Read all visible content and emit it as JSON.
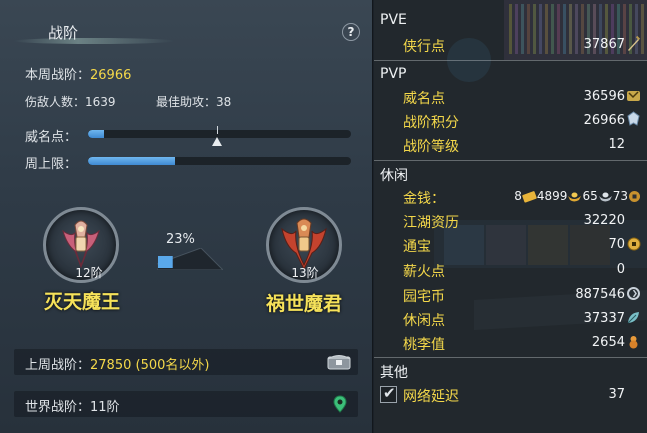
{
  "left": {
    "header": {
      "title": "战阶"
    },
    "help_label": "?",
    "weekly_rank": {
      "label": "本周战阶：",
      "value": "26966"
    },
    "stats": {
      "injured_label": "伤敌人数：",
      "injured_value": "1639",
      "assist_label": "最佳助攻：",
      "assist_value": "38"
    },
    "prestige": {
      "label": "威名点：",
      "fill_fraction": 0.06,
      "marker_fraction": 0.49
    },
    "weekly_cap": {
      "label": "周上限：",
      "fill_fraction": 0.33
    },
    "current_rank": {
      "level": "12阶",
      "name": "灭天魔王"
    },
    "progress_percent": "23%",
    "progress_fraction": 0.23,
    "next_rank": {
      "level": "13阶",
      "name": "祸世魔君"
    },
    "last_week": {
      "label": "上周战阶：",
      "value": "27850 (500名以外)"
    },
    "world_rank": {
      "label": "世界战阶：",
      "value": "11阶"
    }
  },
  "right": {
    "pve": {
      "section": "PVE",
      "items": [
        {
          "label": "侠行点",
          "value": "37867"
        }
      ]
    },
    "pvp": {
      "section": "PVP",
      "items": [
        {
          "label": "威名点",
          "value": "36596"
        },
        {
          "label": "战阶积分",
          "value": "26966"
        },
        {
          "label": "战阶等级",
          "value": "12"
        }
      ]
    },
    "leisure": {
      "section": "休闲",
      "money_label": "金钱：",
      "money": {
        "a": "8",
        "b": "4899",
        "c": "65",
        "d": "73"
      },
      "items": [
        {
          "label": "江湖资历",
          "value": "32220"
        },
        {
          "label": "通宝",
          "value": "70"
        },
        {
          "label": "薪火点",
          "value": "0"
        },
        {
          "label": "园宅币",
          "value": "887546"
        },
        {
          "label": "休闲点",
          "value": "37337"
        },
        {
          "label": "桃李值",
          "value": "2654"
        }
      ]
    },
    "other": {
      "section": "其他",
      "network": {
        "label": "网络延迟",
        "value": "37",
        "checked": true
      }
    }
  }
}
